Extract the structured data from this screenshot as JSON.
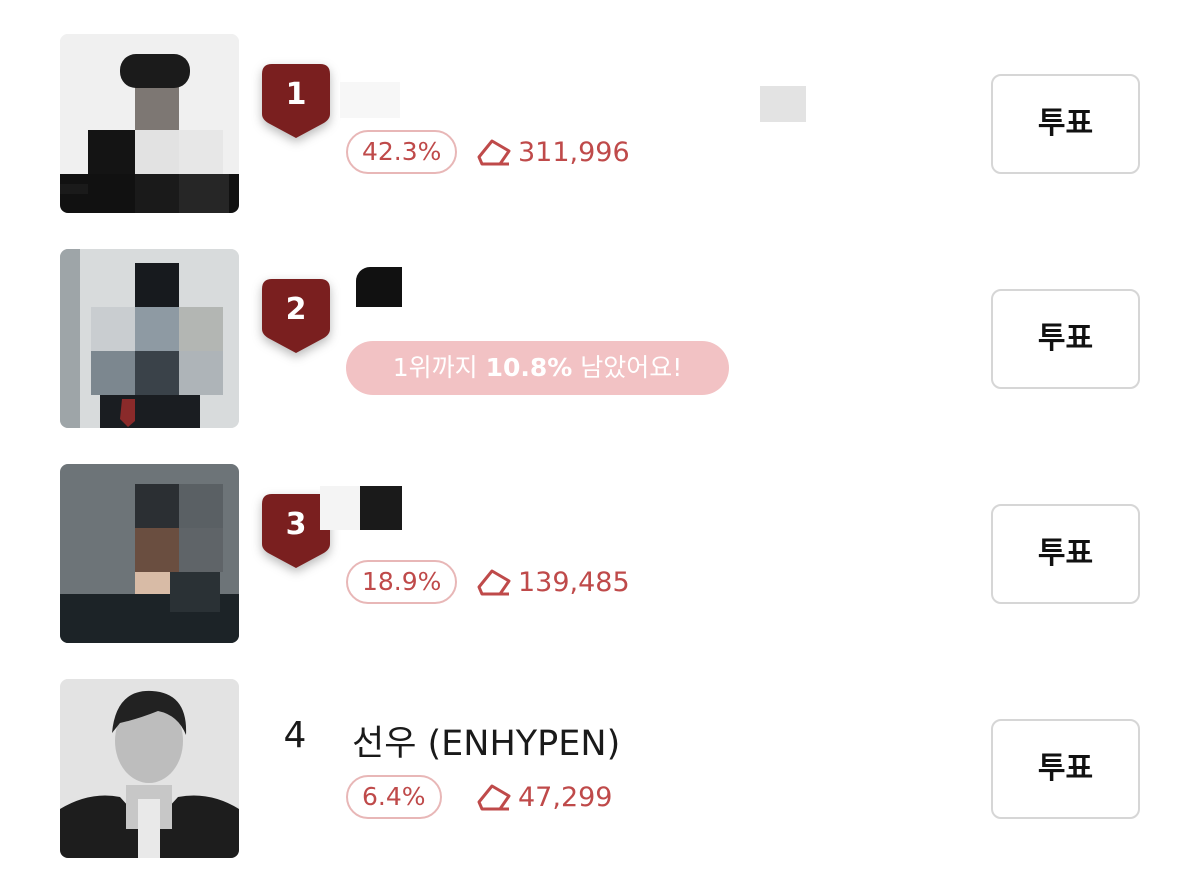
{
  "colors": {
    "badge": "#7a1f1f",
    "accent_text": "#bf4a4a",
    "pill_border": "#e8b7b7",
    "gap_pill_bg": "#f2c2c4"
  },
  "rows": [
    {
      "rank": "1",
      "name": "",
      "percent": "42.3%",
      "votes": "311,996",
      "vote_button": "투표",
      "vote_icon": "eraser-vote-icon"
    },
    {
      "rank": "2",
      "name": "",
      "gap_message": {
        "prefix": "1위까지 ",
        "highlight": "10.8%",
        "suffix": " 남았어요!"
      },
      "vote_button": "투표"
    },
    {
      "rank": "3",
      "name": "",
      "percent": "18.9%",
      "votes": "139,485",
      "vote_button": "투표",
      "vote_icon": "eraser-vote-icon"
    },
    {
      "rank": "4",
      "name": "선우 (ENHYPEN)",
      "percent": "6.4%",
      "votes": "47,299",
      "vote_button": "투표",
      "vote_icon": "eraser-vote-icon"
    }
  ]
}
